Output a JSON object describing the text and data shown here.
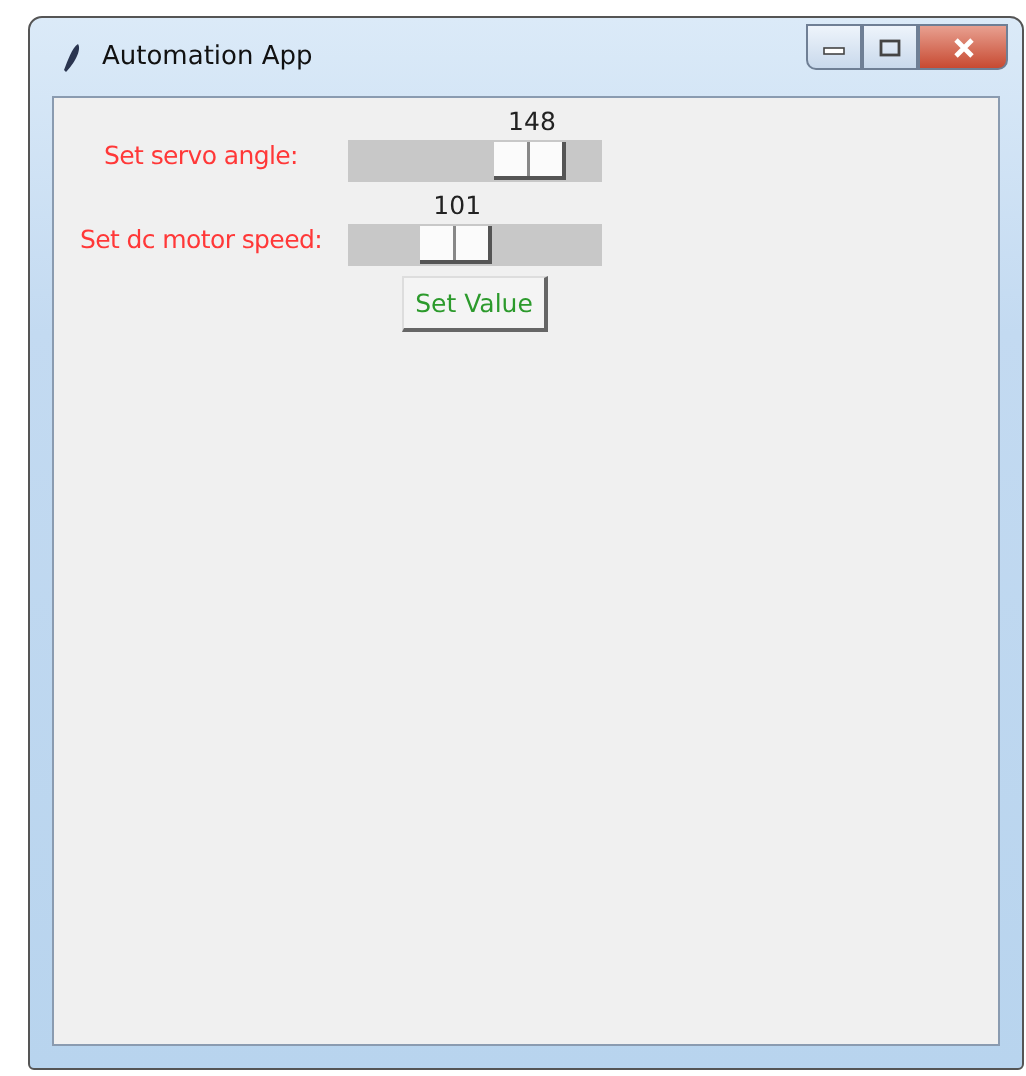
{
  "window": {
    "title": "Automation App"
  },
  "sliders": [
    {
      "label": "Set servo angle:",
      "value": "148",
      "level": 0.82
    },
    {
      "label": "Set dc motor speed:",
      "value": "101",
      "level": 0.4
    }
  ],
  "button": {
    "label": "Set Value"
  }
}
